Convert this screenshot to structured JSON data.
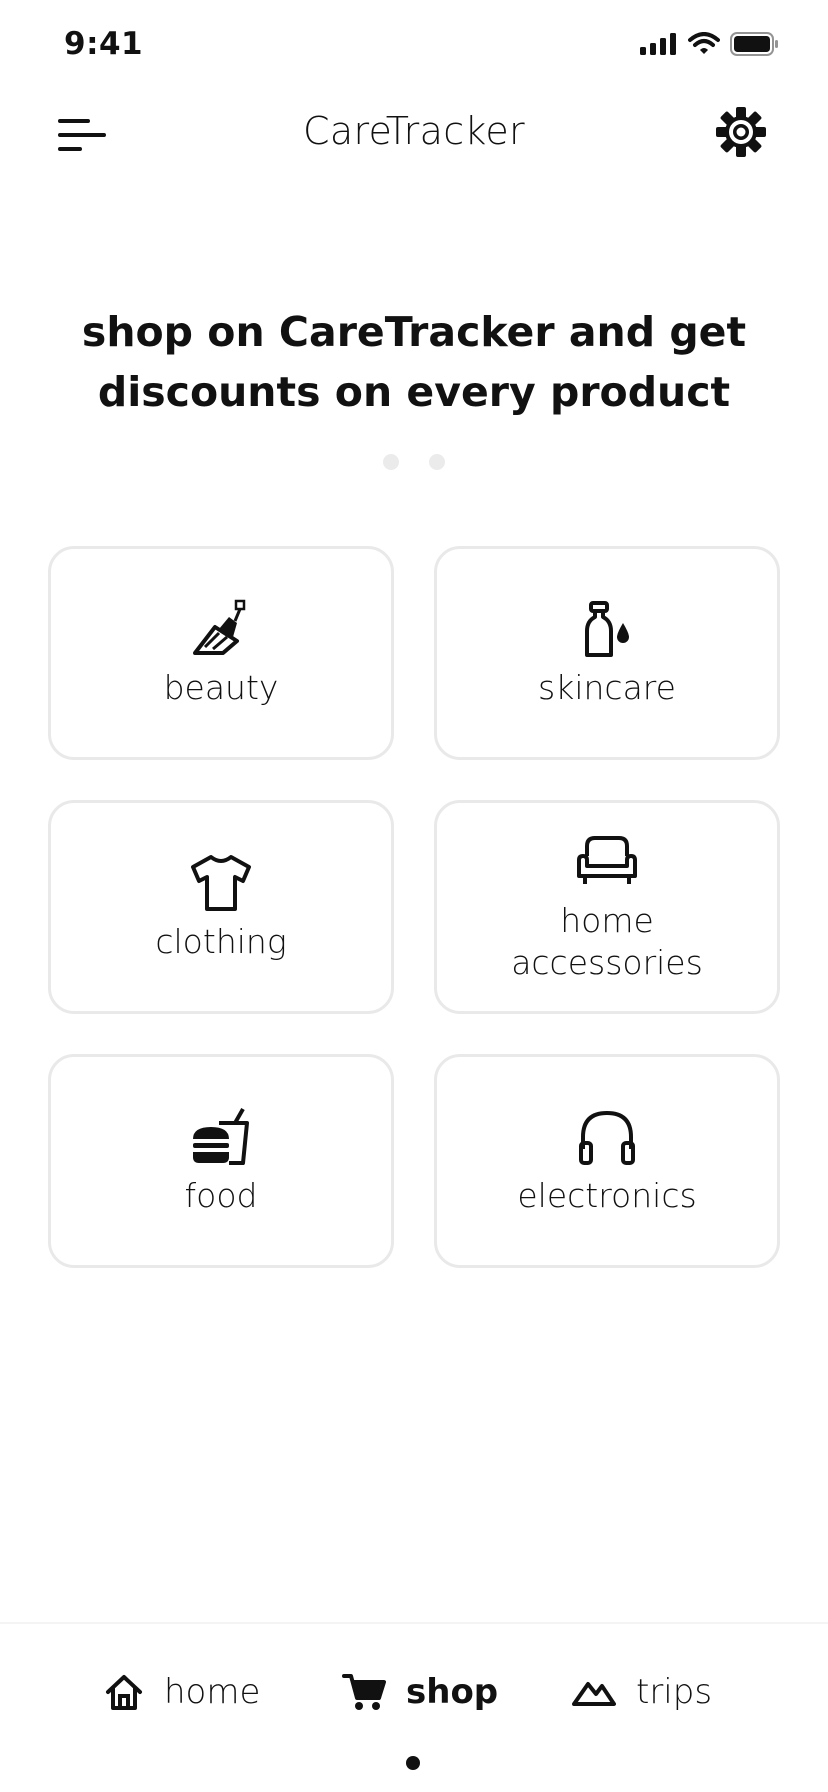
{
  "status_bar": {
    "time": "9:41"
  },
  "header": {
    "title": "CareTracker"
  },
  "promo": {
    "headline": "shop on CareTracker and get discounts on every product"
  },
  "carousel": {
    "pages": 2
  },
  "categories": [
    {
      "label": "beauty",
      "icon": "nail-polish-icon"
    },
    {
      "label": "skincare",
      "icon": "lotion-bottle-icon"
    },
    {
      "label": "clothing",
      "icon": "tshirt-icon"
    },
    {
      "label": "home accessories",
      "icon": "armchair-icon"
    },
    {
      "label": "food",
      "icon": "fast-food-icon"
    },
    {
      "label": "electronics",
      "icon": "headphones-icon"
    }
  ],
  "tab_bar": {
    "tabs": [
      {
        "label": "home",
        "icon": "home-icon",
        "active": false
      },
      {
        "label": "shop",
        "icon": "cart-icon",
        "active": true
      },
      {
        "label": "trips",
        "icon": "mountain-icon",
        "active": false
      }
    ]
  },
  "colors": {
    "text": "#111111",
    "card_border": "#e9e9e9",
    "dot_inactive": "#ebebeb",
    "background": "#ffffff"
  }
}
